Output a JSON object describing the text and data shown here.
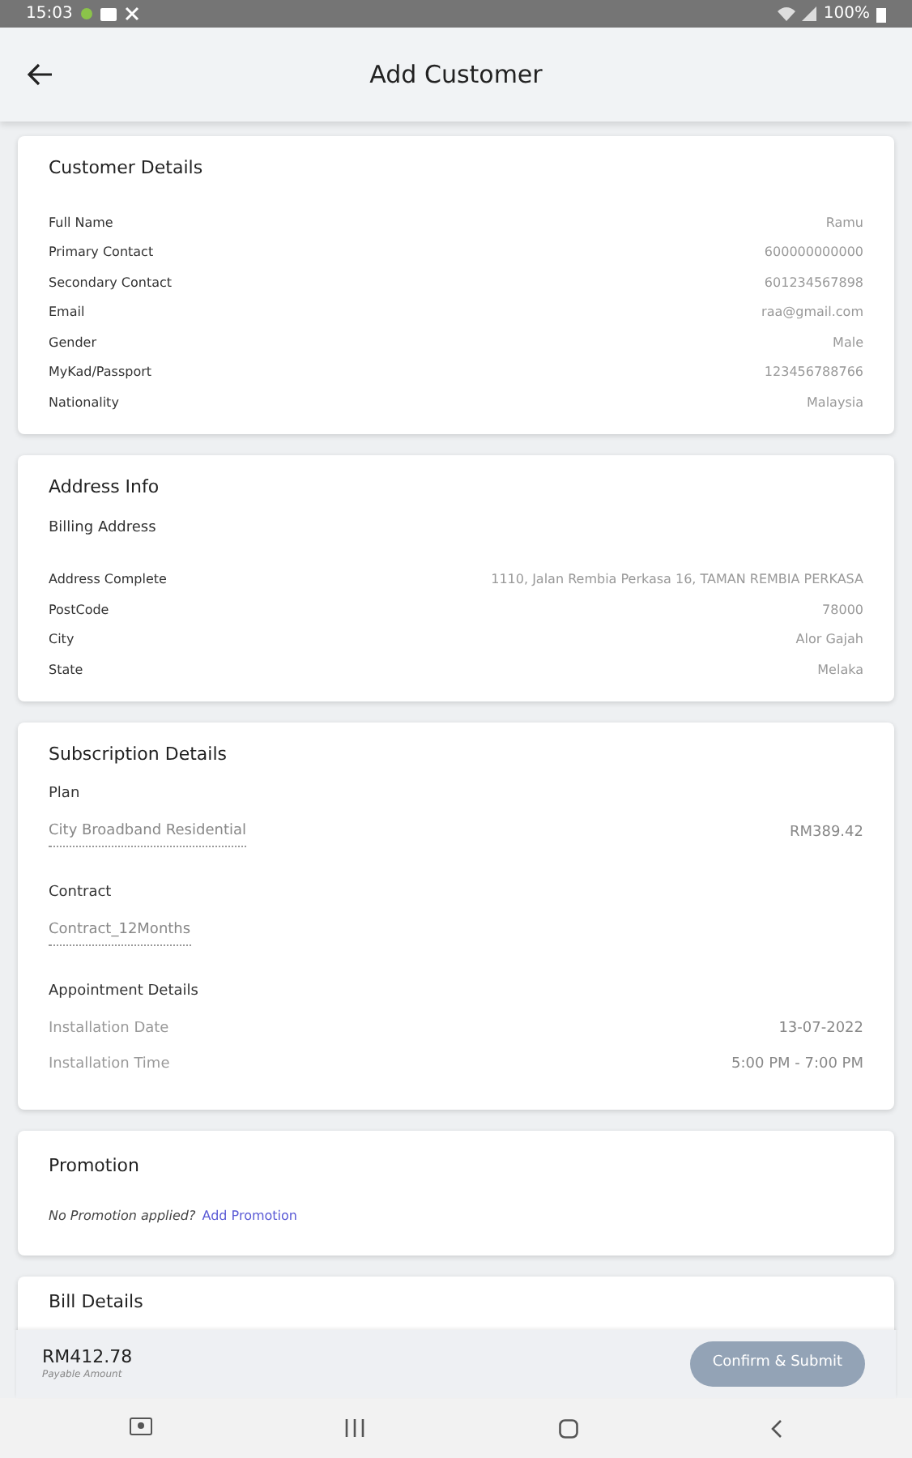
{
  "status_bar": {
    "time": "15:03",
    "battery": "100%"
  },
  "header": {
    "title": "Add Customer"
  },
  "customer_details": {
    "title": "Customer Details",
    "rows": [
      {
        "label": "Full Name",
        "value": "Ramu"
      },
      {
        "label": "Primary Contact",
        "value": "600000000000"
      },
      {
        "label": "Secondary Contact",
        "value": "601234567898"
      },
      {
        "label": "Email",
        "value": "raa@gmail.com"
      },
      {
        "label": "Gender",
        "value": "Male"
      },
      {
        "label": "MyKad/Passport",
        "value": "123456788766"
      },
      {
        "label": "Nationality",
        "value": "Malaysia"
      }
    ]
  },
  "address_info": {
    "title": "Address Info",
    "subtitle": "Billing Address",
    "rows": [
      {
        "label": "Address Complete",
        "value": "1110, Jalan Rembia Perkasa 16, TAMAN REMBIA PERKASA"
      },
      {
        "label": "PostCode",
        "value": "78000"
      },
      {
        "label": "City",
        "value": "Alor Gajah"
      },
      {
        "label": "State",
        "value": "Melaka"
      }
    ]
  },
  "subscription_details": {
    "title": "Subscription Details",
    "plan": {
      "label": "Plan",
      "name": "City Broadband Residential",
      "price": "RM389.42"
    },
    "contract": {
      "label": "Contract",
      "value": "Contract_12Months"
    },
    "appointment": {
      "title": "Appointment Details",
      "rows": [
        {
          "label": "Installation Date",
          "value": "13-07-2022"
        },
        {
          "label": "Installation Time",
          "value": "5:00 PM - 7:00 PM"
        }
      ]
    }
  },
  "promotion": {
    "title": "Promotion",
    "note": "No Promotion applied?",
    "link": "Add Promotion"
  },
  "bill_details": {
    "title": "Bill Details"
  },
  "footer": {
    "amount": "RM412.78",
    "amount_label": "Payable Amount",
    "button": {
      "label": "Confirm & Submit",
      "disabled": true
    }
  }
}
